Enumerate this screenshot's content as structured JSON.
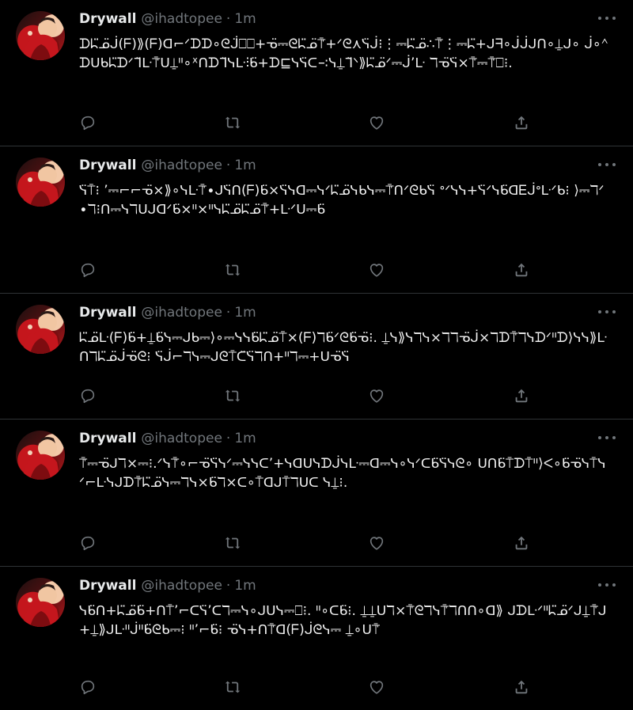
{
  "author": {
    "name": "Drywall",
    "handle": "@ihadtopee"
  },
  "tweets": [
    {
      "time": "1m",
      "text": "ᗪᖺ̈ᓄ̈ᒎ(ᖴ)⟫(ᖴ)ᗡ⌐ᐟᗪᗪ∘ᘓᒎ̈⎕⎕+ᓀ̈⎓ᘓᖺ̈ᓄ̈⍑̍+ᐟᘓ⋏ᓭ̈ᒎ⁝⋮⎓ᖺ̈ᓄ̈∴⍑̍⋮⎓ᖺ̈+ᒍᖷ∘ᒎᒎᒍᑎ∘⍊ᒍ∘ ᒎ∘ᣔᗪᑌᑲᖺ̈ᗪᐟᒣ̈ᒷ⍑̍ᑌ⍊ᐦ∘ᕽᑎᗪᒣ̈ᓭᒷ⫶ᑲ̈+ᗪ⊑ᓭᓭ̈ᑕ∹ᓭ⍊ᒣ̈ᐠ⟫ᖺ̈ᓄ̈ᐟ⎓ᒎ’ᒷ ℸᓀ̈ᓭ̈×⍑̍⎓⍑̍⎕⁝."
    },
    {
      "time": "1m",
      "text": "ᓭ̈⍑⁝ ’⎓⌐⌐ᓀ̈×⟫∘ᓭᒷ⍑̍∙ᒍᓭ̈ᑎ(ᖴ)ᑲ̈×ᓭ̈ᓭᗡ⎓ᓭᐟᖺ̈ᓄ̈ᓭᑲᓭ⎓⍑̍ᑎᐟᘓᑲᓭ̈ ᐤᐟᓭᓭ+ᓭ̈ᐟᓭᑲ̈ᗡᎬᒎᐤᒷᐟᑲ⁝ ⟩⎓ℸᐟ ∙ℸ⁝ᑎ⎓ᓭℸᑌᒍᗡᐟᑲ̈×ᐦ×ᐦᓭᖺ̈ᓄ̈ᖺ̈ᓄ̈⍑̍+ᒷᐟᑌ⎓ᑲ̈"
    },
    {
      "time": "1m",
      "text": "ᖺ̈ᓄ̈ᒷ(ᖴ)ᑲ̈+⍊ᑲ̈ᓭ⎓ᒍᑲ⎓⟩∘⎓ᓭᓭᑲ̈ᖺ̈ᓄ̈⍑×(ᖴ)ℸᑲ̈ᐟᘓᑲ̈ᓀ̈⁝. ⍊ᓭ⟫ᓭℸᓭ×ℸℸᓀ̈ᒎ×ℸᗪ⍑̍ℸᓭᗪᐟᐦᗪ⟩ᓭᓭ⟫ᒷᑎℸᖺ̈ᓄ̈ᒎᓀ̈ᘓ⁝ ᓭ̈ᒎ⌐ℸᓭ⎓ᒍᘓ⍑ᑕ̈ᓭ̈ℸᑎ+ᐦℸ⎓+ᑌᓀ̈ᓭ̈"
    },
    {
      "time": "1m",
      "text": "⍑̍⎓ᓀ̈ᒍℸ×⎓⁝.ᐟᓭ⍑̍∘⌐ᓀ̈ᓭ̈ᓭᐟ⎓ᓭᓭᑕ’+ᓭᗡᑌᓭᗪᒎᓭᒷ⎓ᗡ⎓ᓭ∘ᓭᐟᑕᑲ̈ᓭ̈ᓭᘓ∘ ᑌᑎᑲ̈⍑ᗪ⍑ᐦ⟩ᐸ∘ᑲ̈ᓀ̈ᓭ⍑ᓭᐟ⌐ᒷᓭᒍᗪ⍑̍ᖺ̈ᓄ̈ᓭ⎓ℸᓭ×ᑲ̈ℸ×ᑕ∘⍑ᗡᒍ⍑ℸᑌᑕ ᓭ⍊⁝."
    },
    {
      "time": "1m",
      "text": "ᓭᑲ̈ᑎ+ᖺ̈ᓄ̈ᑲ̈+ᑎ⍑’⌐ᑕᓭ̈’ᑕℸ⎓ᓭ∘ᒍᑌᓭ⎓⎕⁝. ᐦ∘ᑕᑲ̈⁝. ⍊⍊ᑌℸ×⍑̍ᘓℸᓭ⍑̍ℸᑎᑎ∘ᗡ⟫ ᒍᗪᒷᐟᐦᖺ̈ᓄ̈ᐟᒍ⍊⍑̍ᒍ+⍊⟫ᒍᒷᐦᒎᐦᑲ̈ᘓᑲ⎓⁝ ᐦ’⌐ᑲ̈⁝ ᓀ̈ᓭ+ᑎ⍑̍ᗡ(ᖴ)ᒎᘓᓭ⎓ ⍊∘ᑌ⍑̍"
    }
  ]
}
